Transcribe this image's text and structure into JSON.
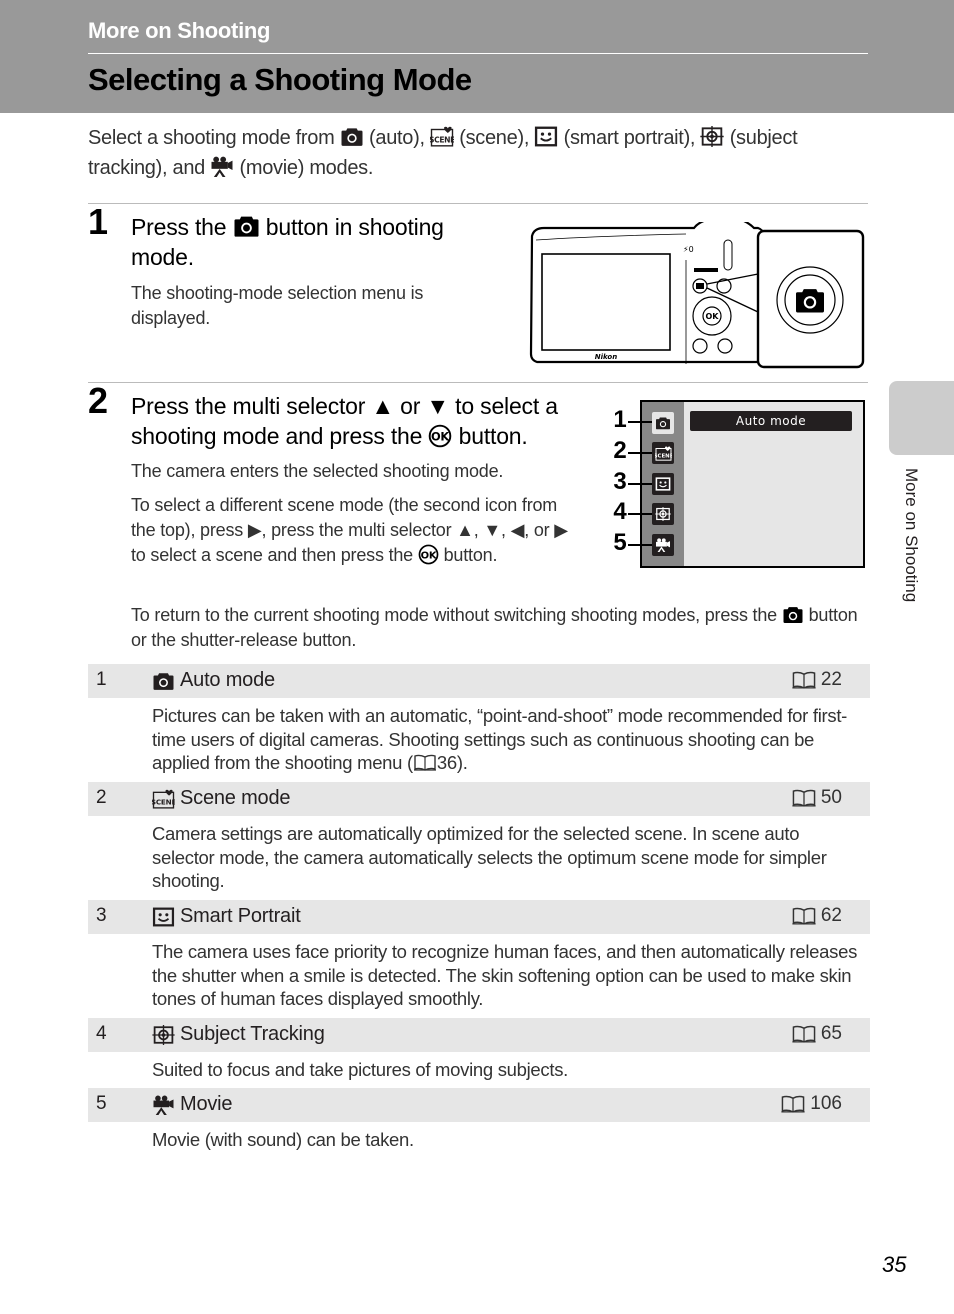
{
  "header": {
    "chapter": "More on Shooting",
    "title": "Selecting a Shooting Mode"
  },
  "intro": {
    "p1": "Select a shooting mode from",
    "auto": " (auto), ",
    "scene": " (scene), ",
    "smart": " (smart portrait), ",
    "subject": " (subject tracking), and ",
    "movie": " (movie) modes."
  },
  "step1": {
    "number": "1",
    "head_a": "Press the",
    "head_b": "button in shooting mode.",
    "body": "The shooting-mode selection menu is displayed.",
    "camera_brand": "Nikon"
  },
  "step2": {
    "number": "2",
    "head_a": "Press the multi selector ▲ or ▼ to select a shooting mode and press the",
    "ok_symbol": "OK",
    "head_b": "button.",
    "body1": "The camera enters the selected shooting mode.",
    "body2_a": "To select a different scene mode (the second icon from the top), press ▶, press the multi selector ▲, ▼, ◀, or ▶ to select a scene and then press the",
    "body2_b": "button.",
    "body3_b": "button or the shutter-release button.",
    "body3_a": "To return to the current shooting mode without switching shooting modes, press the"
  },
  "menu_screen": {
    "selected_label": "Auto mode",
    "callouts": [
      "1",
      "2",
      "3",
      "4",
      "5"
    ]
  },
  "modes": [
    {
      "index": "1",
      "icon": "camera-icon",
      "name": "Auto mode",
      "ref": "22",
      "desc": "Pictures can be taken with an automatic, “point-and-shoot” mode recommended for first-time users of digital cameras. Shooting settings such as continuous shooting can be applied from the shooting menu (",
      "desc_ref": "36",
      "desc_end": ")."
    },
    {
      "index": "2",
      "icon": "scene-icon",
      "name": "Scene mode",
      "ref": "50",
      "desc": "Camera settings are automatically optimized for the selected scene. In scene auto selector mode, the camera automatically selects the optimum scene mode for simpler shooting."
    },
    {
      "index": "3",
      "icon": "smart-portrait-icon",
      "name": "Smart Portrait",
      "ref": "62",
      "desc": "The camera uses face priority to recognize human faces, and then automatically releases the shutter when a smile is detected. The skin softening option can be used to make skin tones of human faces displayed smoothly."
    },
    {
      "index": "4",
      "icon": "subject-tracking-icon",
      "name": "Subject Tracking",
      "ref": "65",
      "desc": "Suited to focus and take pictures of moving subjects."
    },
    {
      "index": "5",
      "icon": "movie-icon",
      "name": "Movie",
      "ref": "106",
      "desc": "Movie (with sound) can be taken."
    }
  ],
  "side_tab": {
    "label": "More on Shooting"
  },
  "footer": {
    "page_number": "35"
  }
}
